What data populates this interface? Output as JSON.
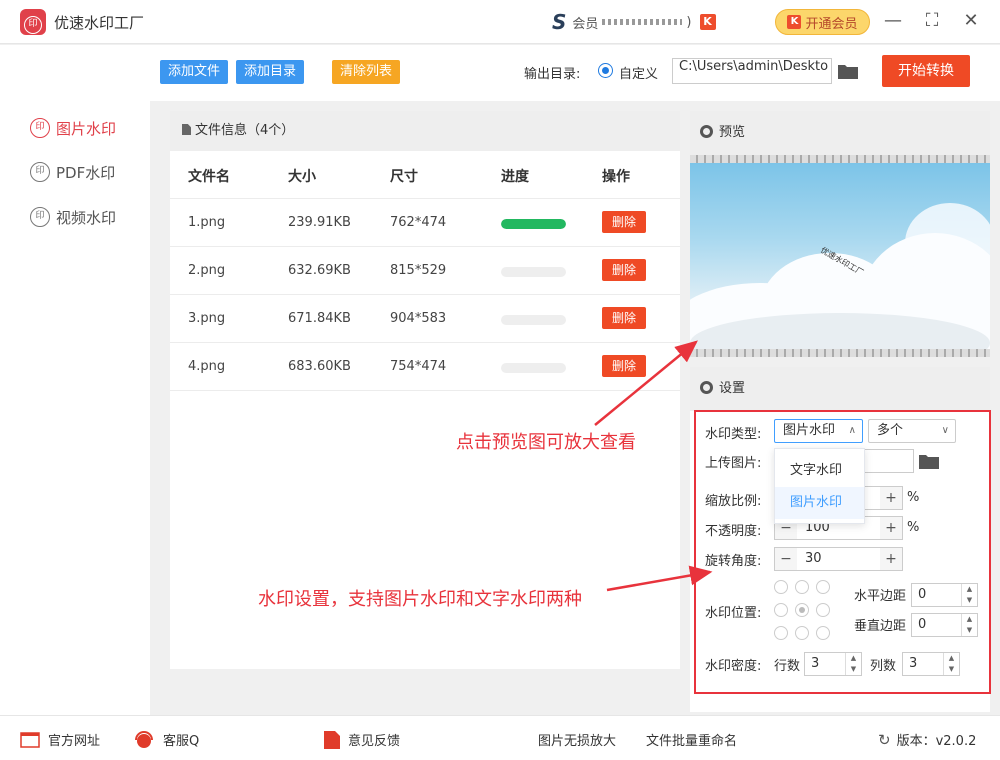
{
  "app": {
    "title": "优速水印工厂",
    "logo_text": "印"
  },
  "titlebar": {
    "member_prefix": "会员",
    "member_suffix": ")",
    "vip_label": "开通会员",
    "vip_icon": "K",
    "minimize": "—",
    "maximize": "⛶",
    "close": "✕"
  },
  "sidebar": {
    "items": [
      {
        "label": "图片水印",
        "icon": "印",
        "active": true
      },
      {
        "label": "PDF水印",
        "icon": "印",
        "active": false
      },
      {
        "label": "视频水印",
        "icon": "印",
        "active": false
      }
    ]
  },
  "toolbar": {
    "add_file": "添加文件",
    "add_dir": "添加目录",
    "clear_list": "清除列表",
    "output_label": "输出目录:",
    "custom_label": "自定义",
    "output_path": "C:\\Users\\admin\\Deskto",
    "start_label": "开始转换"
  },
  "file_panel": {
    "header": "文件信息（4个）",
    "columns": [
      "文件名",
      "大小",
      "尺寸",
      "进度",
      "操作"
    ],
    "rows": [
      {
        "name": "1.png",
        "size": "239.91KB",
        "dims": "762*474",
        "progress": 1.0,
        "action": "删除"
      },
      {
        "name": "2.png",
        "size": "632.69KB",
        "dims": "815*529",
        "progress": 0.0,
        "action": "删除"
      },
      {
        "name": "3.png",
        "size": "671.84KB",
        "dims": "904*583",
        "progress": 0.0,
        "action": "删除"
      },
      {
        "name": "4.png",
        "size": "683.60KB",
        "dims": "754*474",
        "progress": 0.0,
        "action": "删除"
      }
    ],
    "progress_color": "#22b860"
  },
  "preview": {
    "title": "预览",
    "watermark_text": "优速水印工厂"
  },
  "settings": {
    "title": "设置",
    "type_label": "水印类型:",
    "type_value": "图片水印",
    "count_value": "多个",
    "upload_label": "上传图片:",
    "scale_label": "缩放比例:",
    "opacity_label": "不透明度:",
    "opacity_value": "100",
    "rotate_label": "旋转角度:",
    "rotate_value": "30",
    "position_label": "水印位置:",
    "h_margin_label": "水平边距",
    "h_margin_value": "0",
    "v_margin_label": "垂直边距",
    "v_margin_value": "0",
    "density_label": "水印密度:",
    "rows_label": "行数",
    "rows_value": "3",
    "cols_label": "列数",
    "cols_value": "3",
    "percent": "%",
    "dropdown_options": [
      "文字水印",
      "图片水印"
    ],
    "dropdown_selected": "图片水印"
  },
  "annotations": {
    "preview_hint": "点击预览图可放大查看",
    "settings_hint": "水印设置，支持图片水印和文字水印两种"
  },
  "footer": {
    "website": "官方网址",
    "service": "客服Q",
    "feedback": "意见反馈",
    "lossless": "图片无损放大",
    "rename": "文件批量重命名",
    "version": "版本：v2.0.2"
  },
  "colors": {
    "accent_red": "#ef4a25",
    "blue": "#3c97f0",
    "orange": "#f6a623",
    "annotation_red": "#e8333c"
  }
}
